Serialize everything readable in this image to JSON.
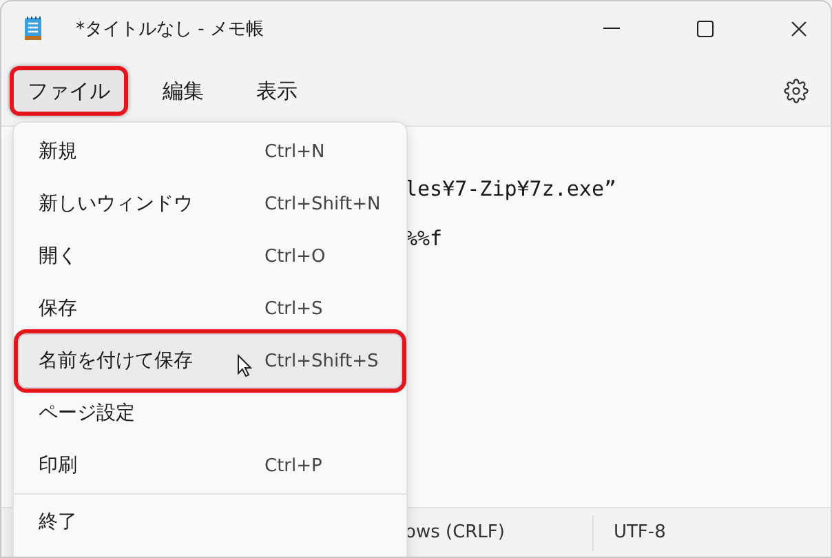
{
  "window": {
    "title": "*タイトルなし - メモ帳"
  },
  "menubar": [
    {
      "label": "ファイル",
      "selected": true,
      "annotated": true
    },
    {
      "label": "編集",
      "selected": false,
      "annotated": false
    },
    {
      "label": "表示",
      "selected": false,
      "annotated": false
    }
  ],
  "editor": {
    "lines": [
      "les¥7-Zip¥7z.exe”",
      "%%f"
    ]
  },
  "file_menu": {
    "items": [
      {
        "kind": "item",
        "label": "新規",
        "shortcut": "Ctrl+N",
        "selected": false,
        "annotated": false
      },
      {
        "kind": "item",
        "label": "新しいウィンドウ",
        "shortcut": "Ctrl+Shift+N",
        "selected": false,
        "annotated": false
      },
      {
        "kind": "item",
        "label": "開く",
        "shortcut": "Ctrl+O",
        "selected": false,
        "annotated": false
      },
      {
        "kind": "item",
        "label": "保存",
        "shortcut": "Ctrl+S",
        "selected": false,
        "annotated": false
      },
      {
        "kind": "item",
        "label": "名前を付けて保存",
        "shortcut": "Ctrl+Shift+S",
        "selected": true,
        "annotated": true
      },
      {
        "kind": "item",
        "label": "ページ設定",
        "selected": false,
        "annotated": false
      },
      {
        "kind": "item",
        "label": "印刷",
        "shortcut": "Ctrl+P",
        "selected": false,
        "annotated": false
      },
      {
        "kind": "separator"
      },
      {
        "kind": "item",
        "label": "終了",
        "selected": false,
        "annotated": false
      }
    ]
  },
  "status_bar": [
    "ows (CRLF)",
    "UTF-8"
  ]
}
